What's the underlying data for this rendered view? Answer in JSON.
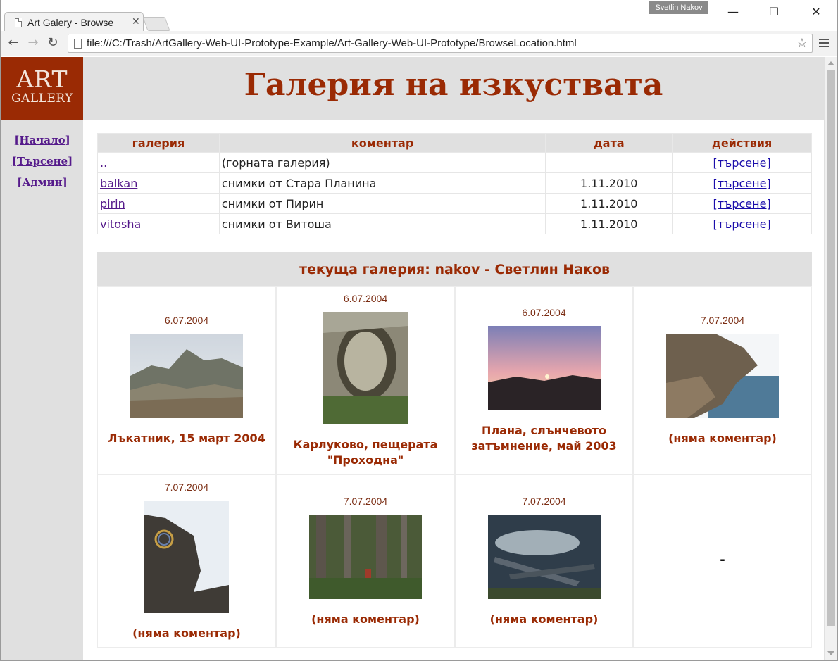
{
  "browser": {
    "tab_title": "Art Galery - Browse",
    "user_badge": "Svetlin Nakov",
    "url": "file:///C:/Trash/ArtGallery-Web-UI-Prototype-Example/Art-Gallery-Web-UI-Prototype/BrowseLocation.html"
  },
  "logo": {
    "line1": "ART",
    "line2": "GALLERY"
  },
  "site_title": "Галерия на изкуствата",
  "sidebar": {
    "items": [
      {
        "label": "[Начало]"
      },
      {
        "label": "[Търсене]"
      },
      {
        "label": "[Админ]"
      }
    ]
  },
  "galleries": {
    "headers": {
      "gallery": "галерия",
      "comment": "коментар",
      "date": "дата",
      "actions": "действия"
    },
    "rows": [
      {
        "name": "..",
        "comment": "(горната галерия)",
        "date": "",
        "action": "[търсене]"
      },
      {
        "name": "balkan",
        "comment": "снимки от Стара Планина",
        "date": "1.11.2010",
        "action": "[търсене]"
      },
      {
        "name": "pirin",
        "comment": "снимки от Пирин",
        "date": "1.11.2010",
        "action": "[търсене]"
      },
      {
        "name": "vitosha",
        "comment": "снимки от Витоша",
        "date": "1.11.2010",
        "action": "[търсене]"
      }
    ]
  },
  "current_gallery": {
    "heading": "текуща галерия: nakov - Светлин Наков",
    "photos": [
      {
        "date": "6.07.2004",
        "caption": "Лъкатник, 15 март 2004"
      },
      {
        "date": "6.07.2004",
        "caption": "Карлуково, пещерата \"Проходна\""
      },
      {
        "date": "6.07.2004",
        "caption": "Плана, слънчевото затъмнение, май 2003"
      },
      {
        "date": "7.07.2004",
        "caption": "(няма коментар)"
      },
      {
        "date": "7.07.2004",
        "caption": "(няма коментар)"
      },
      {
        "date": "7.07.2004",
        "caption": "(няма коментар)"
      },
      {
        "date": "7.07.2004",
        "caption": "(няма коментар)"
      }
    ],
    "empty_cell": "-"
  }
}
